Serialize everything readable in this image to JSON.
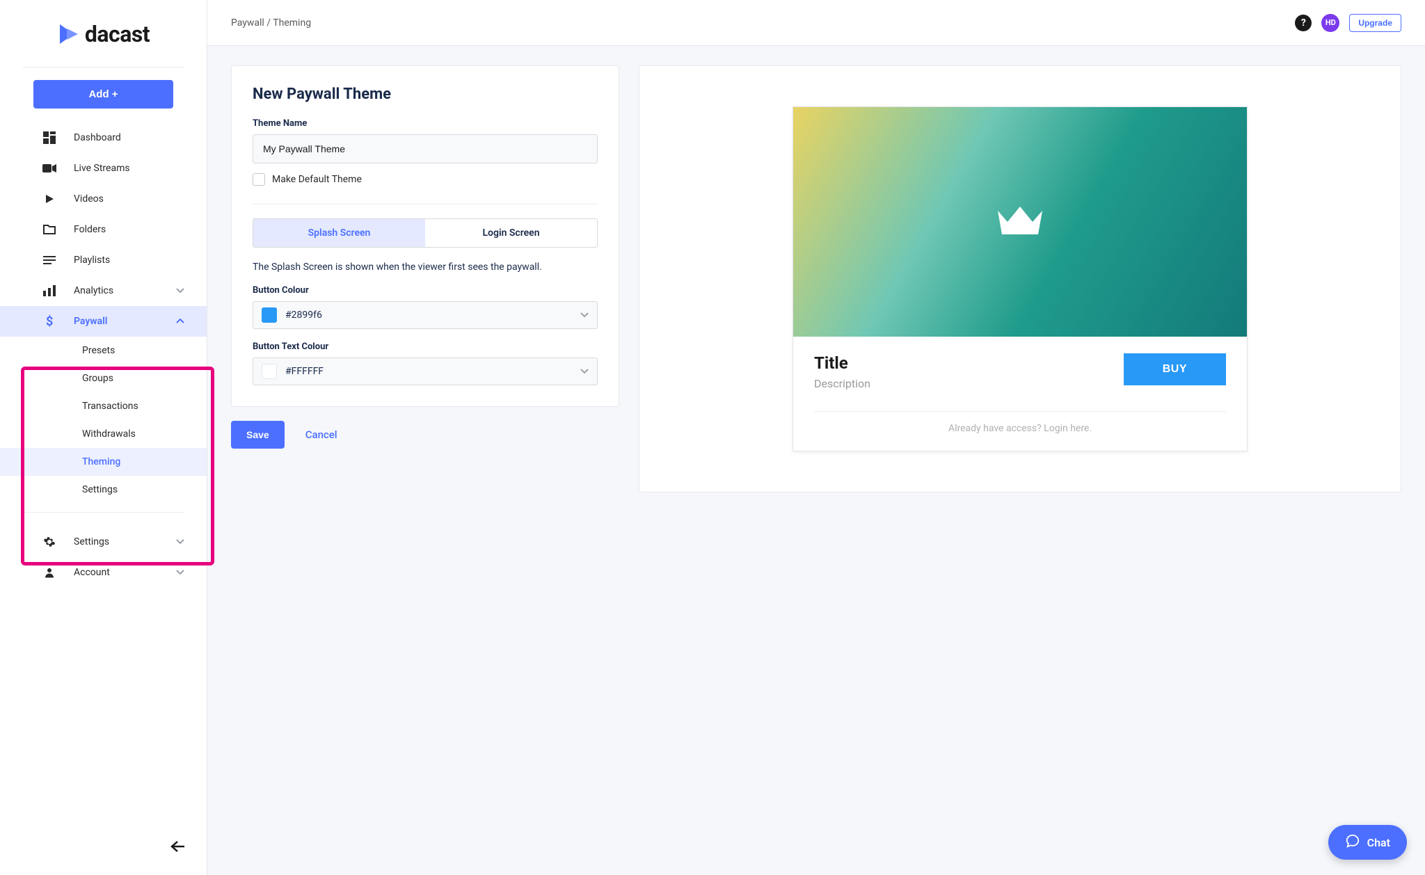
{
  "logo": {
    "text": "dacast"
  },
  "sidebar": {
    "add_label": "Add +",
    "items": [
      {
        "label": "Dashboard"
      },
      {
        "label": "Live Streams"
      },
      {
        "label": "Videos"
      },
      {
        "label": "Folders"
      },
      {
        "label": "Playlists"
      },
      {
        "label": "Analytics"
      },
      {
        "label": "Paywall"
      }
    ],
    "paywall_sub": [
      {
        "label": "Presets"
      },
      {
        "label": "Groups"
      },
      {
        "label": "Transactions"
      },
      {
        "label": "Withdrawals"
      },
      {
        "label": "Theming"
      },
      {
        "label": "Settings"
      }
    ],
    "bottom": [
      {
        "label": "Settings"
      },
      {
        "label": "Account"
      }
    ]
  },
  "topbar": {
    "breadcrumb": "Paywall  /  Theming",
    "help": "?",
    "avatar": "HD",
    "upgrade": "Upgrade"
  },
  "form": {
    "title": "New Paywall Theme",
    "theme_name_label": "Theme Name",
    "theme_name_value": "My Paywall Theme",
    "make_default_label": "Make Default Theme",
    "tab_splash": "Splash Screen",
    "tab_login": "Login Screen",
    "hint": "The Splash Screen is shown when the viewer first sees the paywall.",
    "button_colour_label": "Button Colour",
    "button_colour_value": "#2899f6",
    "button_text_colour_label": "Button Text Colour",
    "button_text_colour_value": "#FFFFFF",
    "save": "Save",
    "cancel": "Cancel"
  },
  "preview": {
    "title": "Title",
    "description": "Description",
    "buy": "BUY",
    "footnote": "Already have access? Login here."
  },
  "chat": {
    "label": "Chat"
  }
}
